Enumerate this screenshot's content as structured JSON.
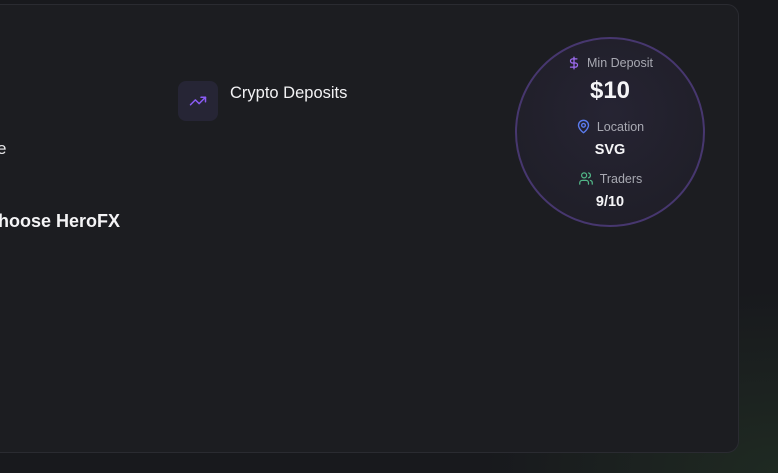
{
  "features": {
    "crypto_deposits": {
      "label": "Crypto Deposits",
      "icon": "trending-up-icon",
      "icon_color": "#8b5cf6"
    }
  },
  "partial_texts": {
    "line_1": "e",
    "heading": "hoose HeroFX"
  },
  "stats": {
    "min_deposit": {
      "label": "Min Deposit",
      "value": "$10",
      "icon": "dollar-icon",
      "icon_color": "#9d6bf0"
    },
    "location": {
      "label": "Location",
      "value": "SVG",
      "icon": "map-pin-icon",
      "icon_color": "#5b7cf0"
    },
    "traders": {
      "label": "Traders",
      "value": "9/10",
      "icon": "users-icon",
      "icon_color": "#52b788"
    }
  },
  "colors": {
    "accent_purple": "#8b5cf6",
    "circle_border": "#47376f",
    "card_background": "#1c1d21"
  }
}
